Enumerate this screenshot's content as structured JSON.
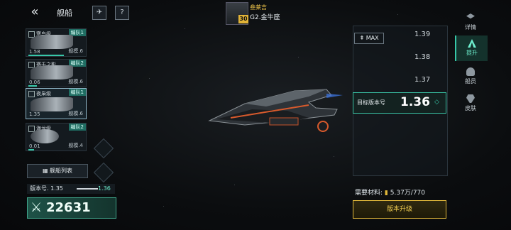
{
  "header": {
    "title": "舰船",
    "pilot_name": "叁莱吉",
    "pilot_rank": "G2.金牛座",
    "pilot_level": "30"
  },
  "ship_list": [
    {
      "name": "寒鸟级",
      "fleet": "编队1",
      "value": "1.58",
      "scale": "舰模.6",
      "selected": false
    },
    {
      "name": "赛千之影",
      "fleet": "编队2",
      "value": "0.06",
      "scale": "舰模.6",
      "selected": false
    },
    {
      "name": "夜枭级",
      "fleet": "编队1",
      "value": "1.35",
      "scale": "舰模.6",
      "selected": true
    },
    {
      "name": "海龙级",
      "fleet": "编队2",
      "value": "0.01",
      "scale": "舰模.4",
      "selected": false
    }
  ],
  "ship_list_button": "舰船列表",
  "version": {
    "label": "版本号. 1.35",
    "target": "1.36"
  },
  "combat_power": "22631",
  "version_panel": {
    "max_label": "MAX",
    "ticks": [
      "1.39",
      "1.38",
      "1.37"
    ],
    "target_label": "目标版本号",
    "target_value": "1.36"
  },
  "materials": {
    "label": "需要材料:",
    "amount": "5.37万/770"
  },
  "upgrade_button": "版本升级",
  "right_nav": [
    {
      "label": "详情",
      "icon": "layers-icon",
      "active": false
    },
    {
      "label": "提升",
      "icon": "upgrade-icon",
      "active": true
    },
    {
      "label": "船员",
      "icon": "crew-icon",
      "active": false
    },
    {
      "label": "皮肤",
      "icon": "skin-icon",
      "active": false
    }
  ],
  "colors": {
    "accent": "#37c7a8",
    "gold": "#e1b83a"
  }
}
